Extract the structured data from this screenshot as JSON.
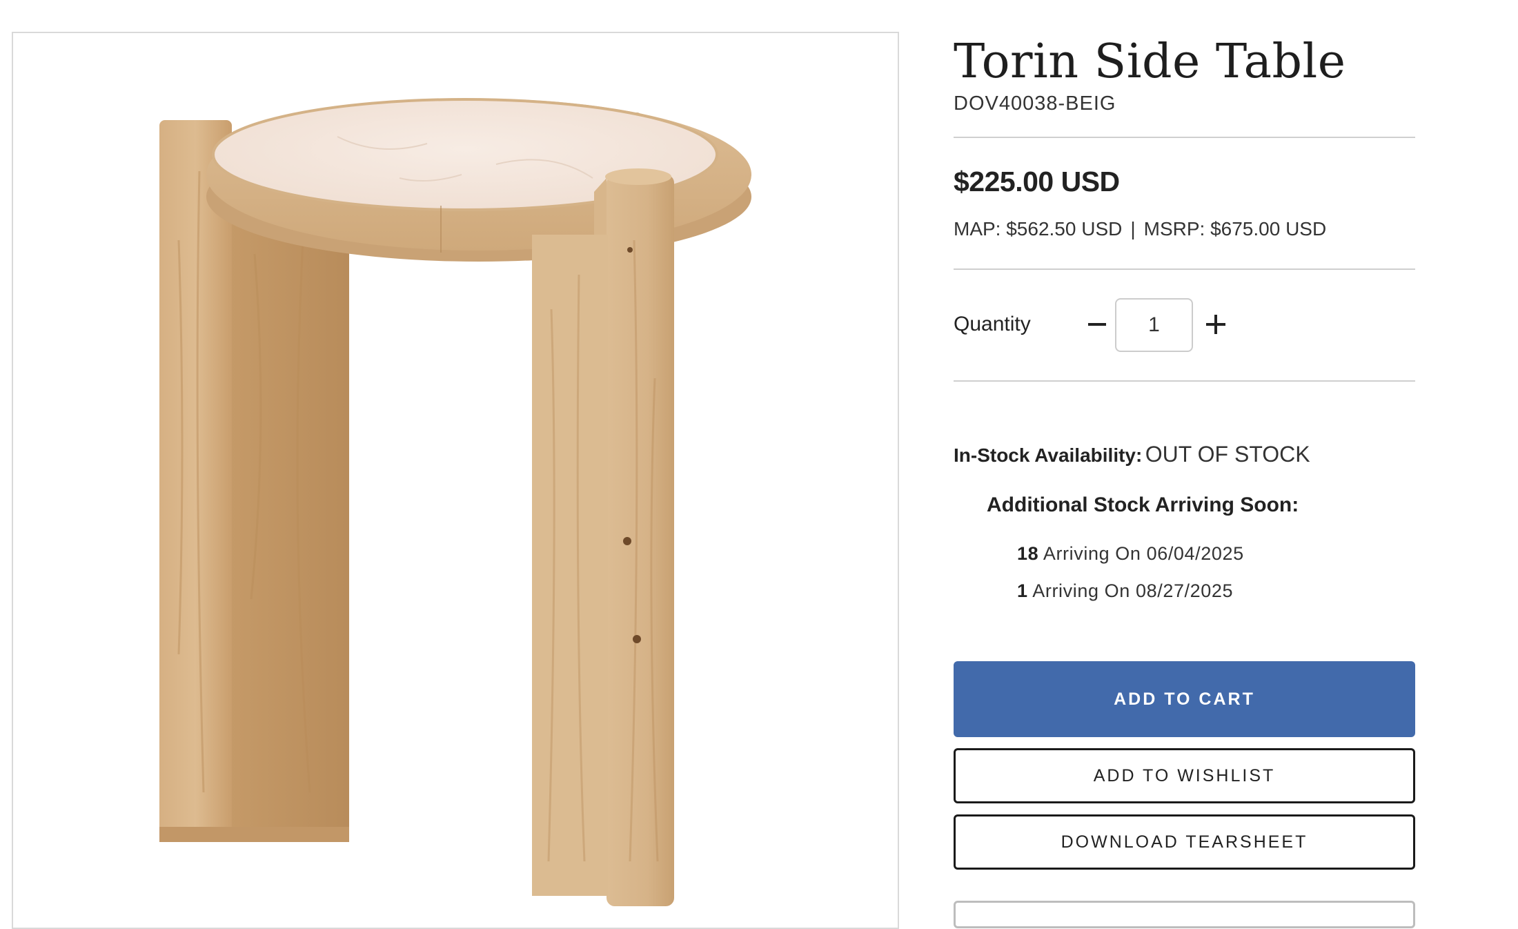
{
  "product": {
    "title": "Torin Side Table",
    "sku": "DOV40038-BEIG",
    "price": "$225.00 USD",
    "map": "MAP: $562.50 USD",
    "separator": "|",
    "msrp": "MSRP: $675.00 USD",
    "image_alt": "Torin Side Table"
  },
  "quantity": {
    "label": "Quantity",
    "value": "1",
    "decrease_icon": "minus-icon",
    "increase_icon": "plus-icon"
  },
  "availability": {
    "label": "In-Stock Availability:",
    "value": "OUT OF STOCK",
    "arriving_title": "Additional Stock Arriving Soon:",
    "arrivals": [
      {
        "qty": "18",
        "text": "Arriving On 06/04/2025"
      },
      {
        "qty": "1",
        "text": "Arriving On 08/27/2025"
      }
    ]
  },
  "actions": {
    "add_to_cart": "ADD TO CART",
    "add_to_wishlist": "ADD TO WISHLIST",
    "download_tearsheet": "DOWNLOAD TEARSHEET"
  },
  "colors": {
    "primary_button": "#426aab",
    "wood": "#d9b88e",
    "marble": "#f4e6dc"
  }
}
